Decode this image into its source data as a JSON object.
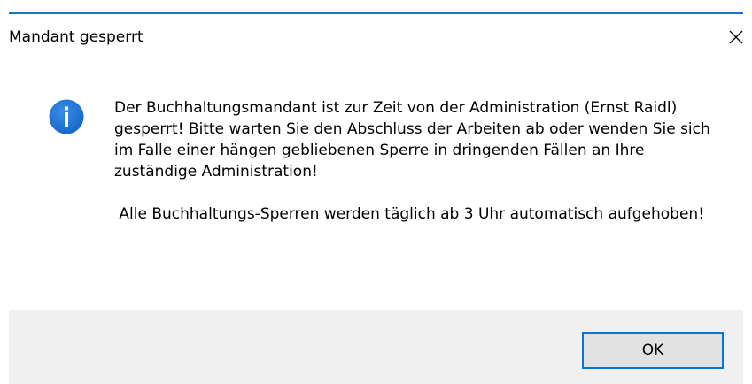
{
  "window": {
    "title": "Mandant gesperrt",
    "close_symbol": "✕",
    "accent_color": "#1a73c9"
  },
  "message": {
    "icon": "info-icon",
    "icon_color": "#1e73d6",
    "paragraph_1": "Der Buchhaltungsmandant ist zur Zeit von der Administration (Ernst Raidl) gesperrt! Bitte warten Sie den Abschluss der Arbeiten ab oder wenden Sie sich im Falle einer hängen gebliebenen Sperre in dringenden Fällen an Ihre zuständige Administration!",
    "paragraph_2": " Alle Buchhaltungs-Sperren werden täglich ab 3 Uhr automatisch aufgehoben!"
  },
  "buttons": {
    "ok_label": "OK",
    "ok_border_color": "#0078d7"
  }
}
